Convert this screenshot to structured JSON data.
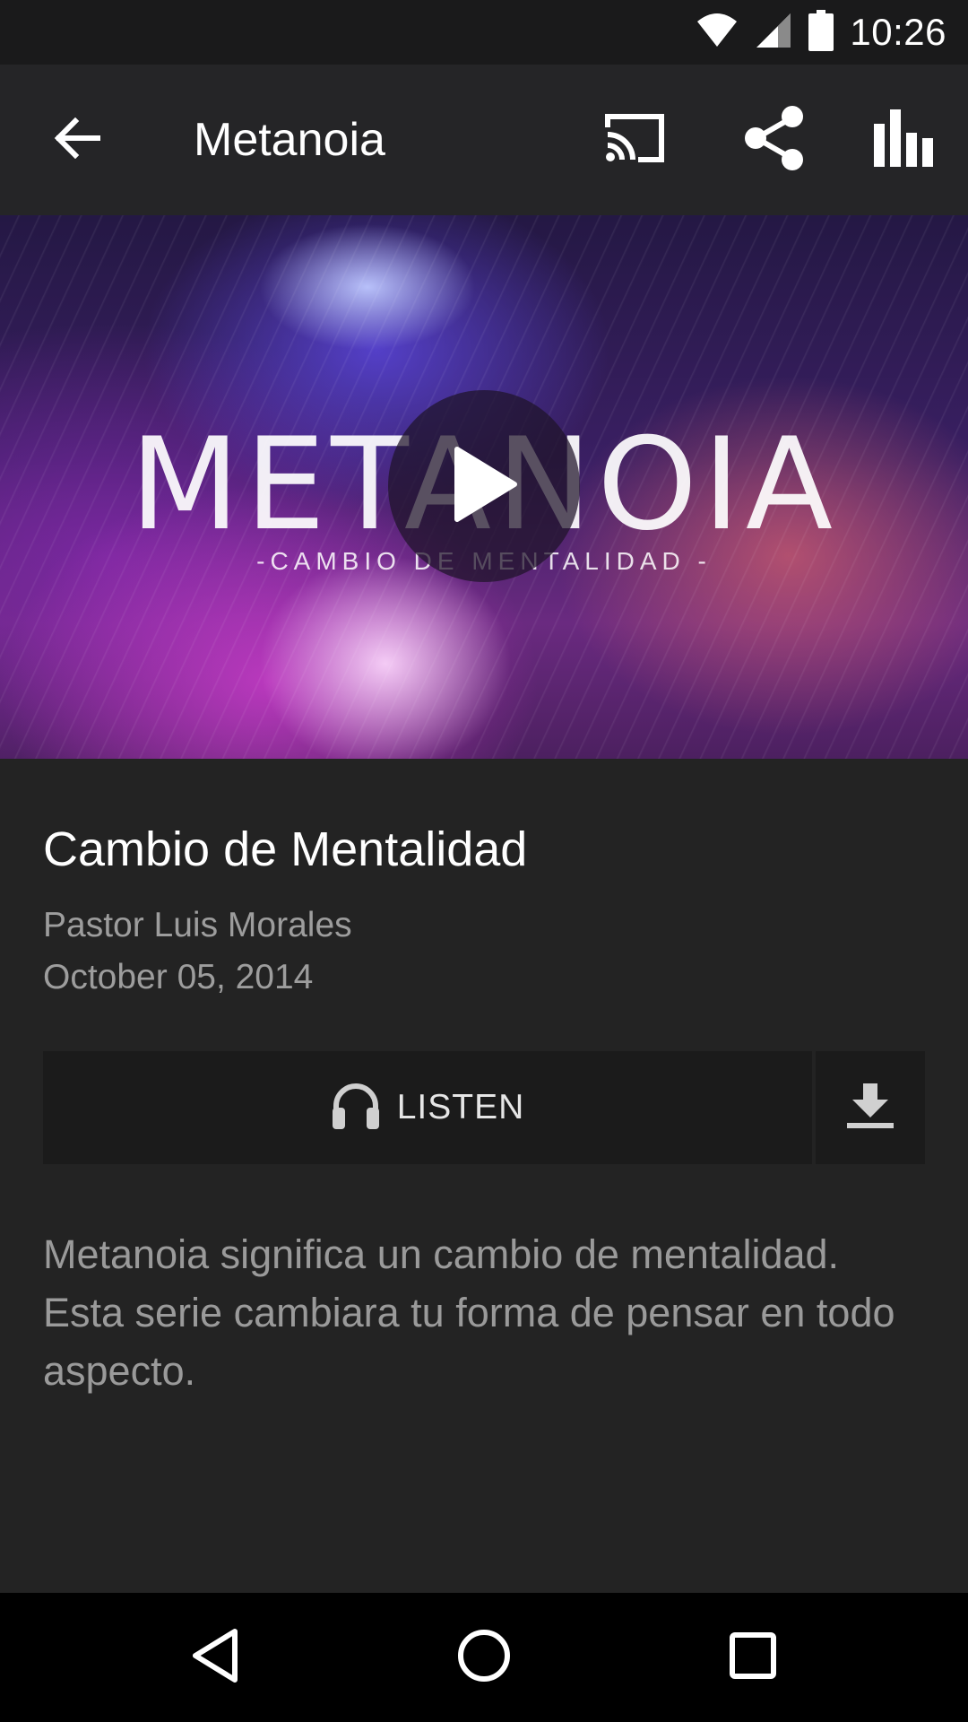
{
  "status_bar": {
    "time": "10:26",
    "icons": [
      "wifi-icon",
      "cell-signal-icon",
      "battery-icon"
    ]
  },
  "app_bar": {
    "back_icon": "arrow-back-icon",
    "title": "Metanoia",
    "actions": [
      "cast-icon",
      "share-icon",
      "equalizer-icon"
    ]
  },
  "hero": {
    "logo_text": "METANOIA",
    "logo_subtitle": "-CAMBIO DE MENTALIDAD -",
    "play_icon": "play-icon"
  },
  "sermon": {
    "title": "Cambio de Mentalidad",
    "speaker": "Pastor Luis Morales",
    "date": "October 05, 2014",
    "listen_label": "LISTEN",
    "listen_icon": "headphones-icon",
    "download_icon": "download-icon",
    "description": "Metanoia significa un cambio de mentalidad. Esta serie cambiara tu forma de pensar en todo aspecto."
  },
  "nav_bar": {
    "buttons": [
      "back-triangle-icon",
      "home-circle-icon",
      "recents-square-icon"
    ]
  },
  "colors": {
    "background": "#232323",
    "app_bar": "#252527",
    "status_bar": "#1a1a1b",
    "nav_bar": "#000000",
    "primary_text": "#ffffff",
    "secondary_text": "#9d9d9d",
    "button_bg": "#1b1b1b"
  }
}
